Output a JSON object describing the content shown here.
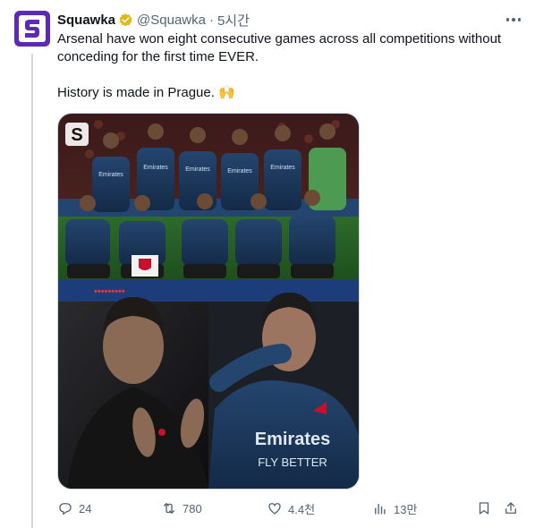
{
  "tweet": {
    "author_name": "Squawka",
    "handle": "@Squawka",
    "separator": "·",
    "time": "5시간",
    "text_line1": "Arsenal have won eight consecutive games across all competitions without conceding for the first time EVER.",
    "text_line2": "History is made in Prague. 🙌",
    "image_logo_letter": "S",
    "jersey_text": "Emirates",
    "jersey_text2": "FLY BETTER"
  },
  "actions": {
    "replies": "24",
    "reposts": "780",
    "likes": "4.4천",
    "views": "13만"
  },
  "colors": {
    "brand_purple": "#5b2bb8",
    "verified_gold": "#e2b719",
    "muted_text": "#536471"
  }
}
